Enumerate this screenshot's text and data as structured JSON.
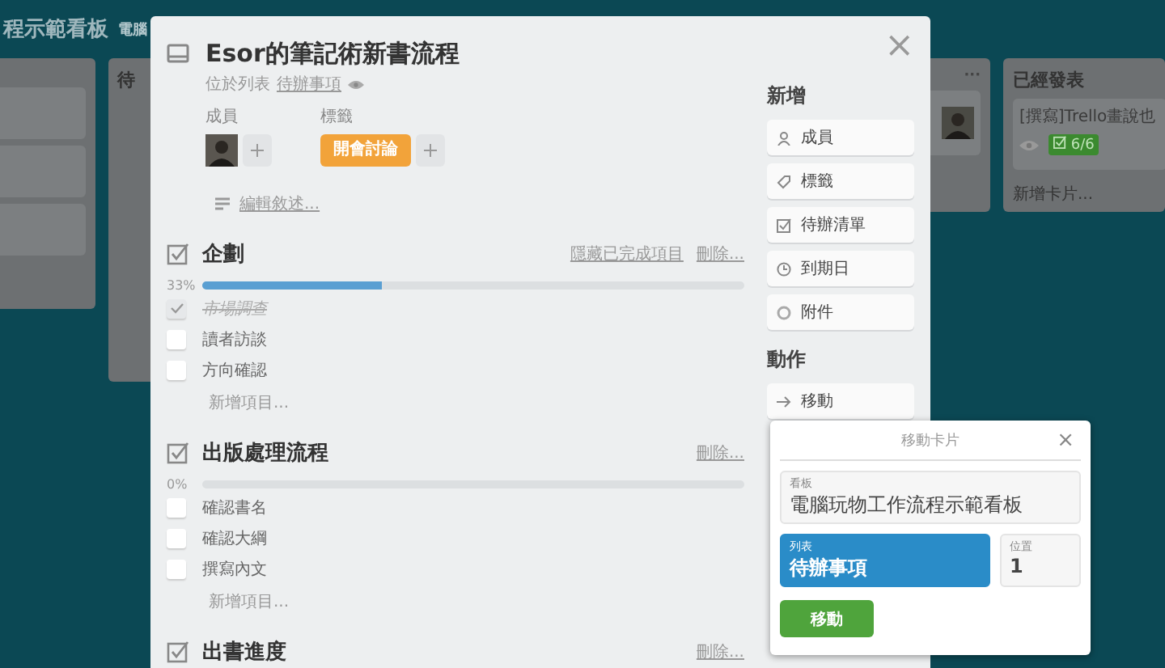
{
  "board": {
    "title": "程示範看板",
    "subtitle": "電腦",
    "lists": [
      {
        "cards": [
          {
            "avatar": false
          },
          {
            "avatar": false
          },
          {
            "avatar": false
          }
        ]
      },
      {
        "title": "待"
      },
      {
        "title": "···",
        "cards": [
          {
            "avatar": true
          }
        ]
      },
      {
        "title": "已經發表",
        "cards": [
          {
            "text": "[撰寫]Trello畫說也",
            "avatar": false,
            "badge": "6/6"
          }
        ],
        "add": "新增卡片..."
      }
    ]
  },
  "card": {
    "close": "×",
    "title": "Esor的筆記術新書流程",
    "list_prefix": "位於列表",
    "list_name": "待辦事項",
    "members_label": "成員",
    "labels_label": "標籤",
    "label": {
      "text": "開會討論",
      "color": "#f2a33a"
    },
    "description_link": "編輯敘述...",
    "checklists": [
      {
        "title": "企劃",
        "hide_link": "隱藏已完成項目",
        "delete_link": "刪除...",
        "percent": "33%",
        "level": 0.33,
        "items": [
          {
            "text": "市場調查",
            "checked": true
          },
          {
            "text": "讀者訪談",
            "checked": false
          },
          {
            "text": "方向確認",
            "checked": false
          }
        ],
        "add": "新增項目..."
      },
      {
        "title": "出版處理流程",
        "delete_link": "刪除...",
        "percent": "0%",
        "level": 0,
        "items": [
          {
            "text": "確認書名",
            "checked": false
          },
          {
            "text": "確認大綱",
            "checked": false
          },
          {
            "text": "撰寫內文",
            "checked": false
          }
        ],
        "add": "新增項目..."
      },
      {
        "title": "出書進度",
        "delete_link": "刪除..."
      }
    ]
  },
  "sidebar": {
    "add_heading": "新增",
    "add_buttons": [
      {
        "kind": "person",
        "label": "成員"
      },
      {
        "kind": "tag",
        "label": "標籤"
      },
      {
        "kind": "checklist",
        "label": "待辦清單"
      },
      {
        "kind": "clock",
        "label": "到期日"
      },
      {
        "kind": "clip",
        "label": "附件"
      }
    ],
    "actions_heading": "動作",
    "actions": [
      {
        "kind": "arrow",
        "label": "移動"
      }
    ]
  },
  "move_popup": {
    "title": "移動卡片",
    "close": "×",
    "board_label": "看板",
    "board_value": "電腦玩物工作流程示範看板",
    "list_label": "列表",
    "list_value": "待辦事項",
    "position_label": "位置",
    "position_value": "1",
    "button": "移動"
  }
}
